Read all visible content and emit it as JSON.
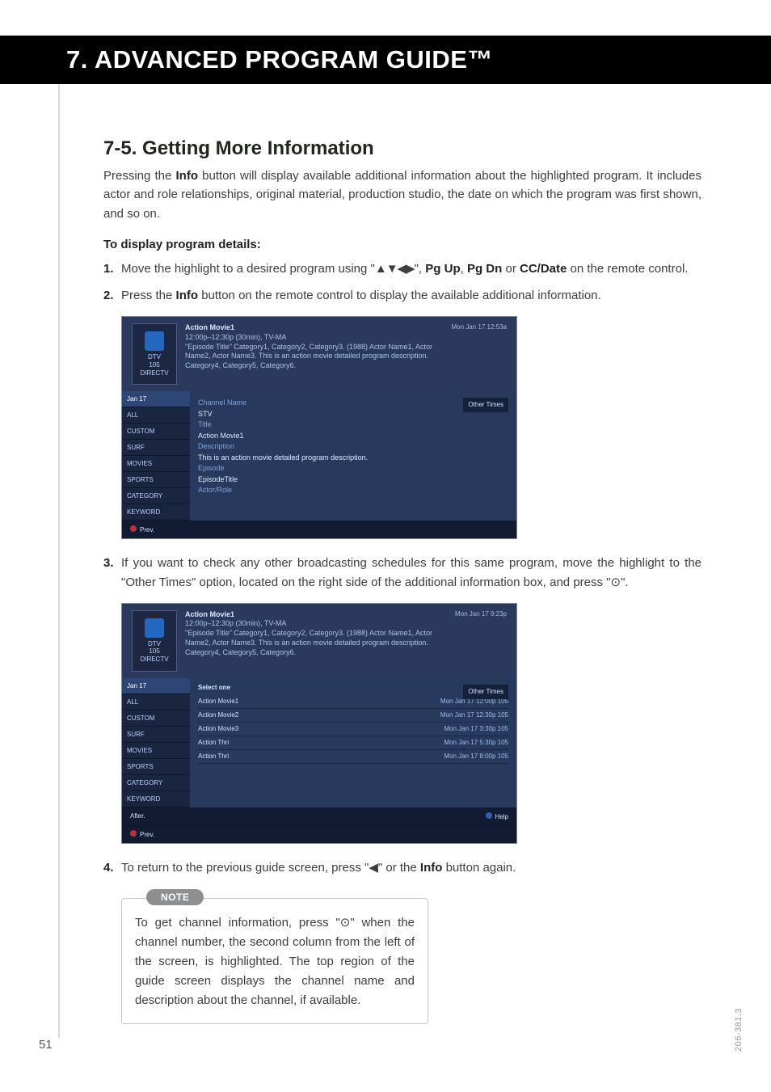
{
  "chapter": {
    "title": "7. ADVANCED PROGRAM GUIDE™"
  },
  "section": {
    "heading": "7-5. Getting More Information"
  },
  "intro": "Pressing the Info button will display available additional information about the highlighted program.  It includes actor and role relationships, original material, production studio, the date on which the program was first shown, and so on.",
  "intro_parts": {
    "a": "Pressing the ",
    "info": "Info",
    "b": " button will display available additional information about the highlighted program.  It includes actor and role relationships, original material, production studio, the date on which the program was first shown, and so on."
  },
  "subhead": "To display program details:",
  "steps": {
    "s1": {
      "num": "1.",
      "a": "Move the highlight to a desired program using \"",
      "arrows": "▲▼◀▶",
      "b": "\", ",
      "pgup": "Pg Up",
      "c": ", ",
      "pgdn": "Pg Dn",
      "d": " or ",
      "cc": "CC/Date",
      "e": " on the remote control."
    },
    "s2": {
      "num": "2.",
      "a": "Press the ",
      "info": "Info",
      "b": " button on the remote control to display the available additional information."
    },
    "s3": {
      "num": "3.",
      "a": "If you want to check any other broadcasting schedules for this same program, move the highlight to the \"Other Times\" option, located on the right side of the additional information box, and press \"",
      "sym": "⊙",
      "b": "\"."
    },
    "s4": {
      "num": "4.",
      "a": "To return to the previous guide screen, press \"",
      "arrow": "◀",
      "b": "\" or the ",
      "info": "Info",
      "c": " button again."
    }
  },
  "note": {
    "label": "NOTE",
    "text_a": "To get channel information, press \"",
    "sym": "⊙",
    "text_b": "\" when the channel number, the second column from the left of the screen, is highlighted.  The top region of the guide screen displays the channel name and description about the channel, if available."
  },
  "page_number": "51",
  "side_code": "206-381.3",
  "shot1": {
    "logo_lines": [
      "DTV",
      "105",
      "DIRECTV"
    ],
    "header_title": "Action Movie1",
    "header_time": "12:00p–12:30p (30min), TV-MA",
    "header_desc": "\"Episode Title\" Category1, Category2, Category3. (1988) Actor Name1, Actor Name2, Actor Name3. This is an action movie detailed program description. Category4, Category5, Category6.",
    "header_right": "Mon Jan 17 12:53a",
    "nav": [
      "Jan 17",
      "ALL",
      "CUSTOM",
      "SURF",
      "MOVIES",
      "SPORTS",
      "CATEGORY",
      "KEYWORD"
    ],
    "details": {
      "channel_label": "Channel Name",
      "channel_val": "STV",
      "title_label": "Title",
      "title_val": "Action Movie1",
      "desc_label": "Description",
      "desc_val": "This is an action movie detailed program description.",
      "episode_label": "Episode",
      "episode_val": "EpisodeTitle",
      "actor_label": "Actor/Role"
    },
    "side_btn": "Other Times",
    "footer": "Prev."
  },
  "shot2": {
    "logo_lines": [
      "DTV",
      "105",
      "DIRECTV"
    ],
    "header_title": "Action Movie1",
    "header_time": "12:00p–12:30p (30min), TV-MA",
    "header_desc": "\"Episode Title\" Category1, Category2, Category3. (1988) Actor Name1, Actor Name2, Actor Name3. This is an action movie detailed program description. Category4, Category5, Category6.",
    "header_right": "Mon Jan 17  9:23p",
    "nav": [
      "Jan 17",
      "ALL",
      "CUSTOM",
      "SURF",
      "MOVIES",
      "SPORTS",
      "CATEGORY",
      "KEYWORD"
    ],
    "list_header": "Select one",
    "rows": [
      {
        "name": "Action Movie1",
        "when": "Mon Jan  17 12:00p 105"
      },
      {
        "name": "Action Movie2",
        "when": "Mon Jan  17 12:30p 105"
      },
      {
        "name": "Action Movie3",
        "when": "Mon Jan  17  3:30p 105"
      },
      {
        "name": "Action Thri",
        "when": "Mon Jan  17  5:30p 105"
      },
      {
        "name": "Action Thri",
        "when": "Mon Jan  17  8:00p 105"
      }
    ],
    "side_btn": "Other Times",
    "footer_left": "After.",
    "footer_right": "Help",
    "footer_prev": "Prev."
  }
}
